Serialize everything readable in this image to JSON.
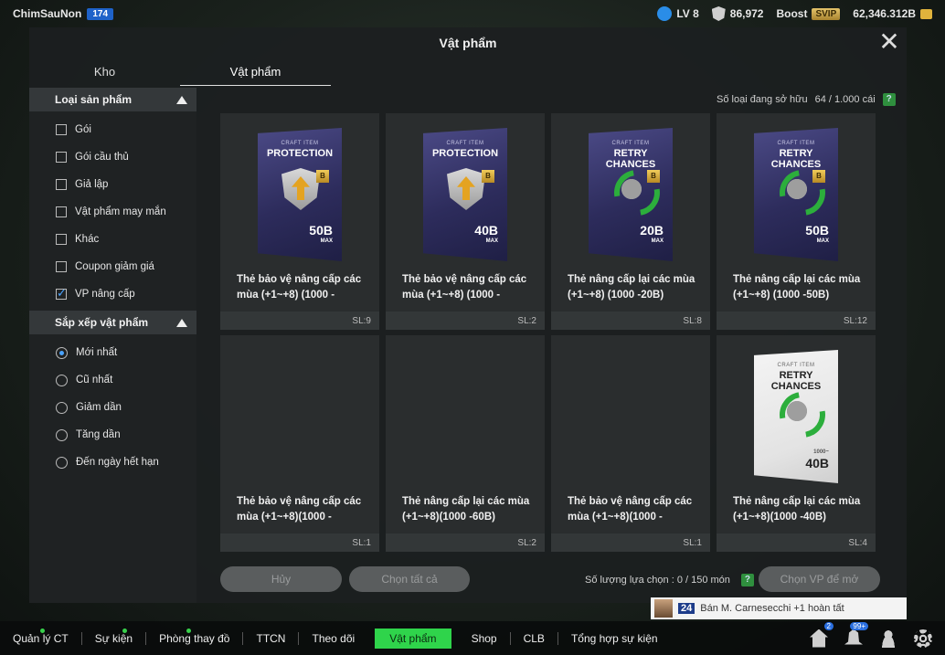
{
  "top": {
    "username": "ChimSauNon",
    "user_level": "174",
    "lv": "LV 8",
    "currency": "86,972",
    "boost_label": "Boost",
    "svip": "SVIP",
    "bp": "62,346.312B"
  },
  "modal": {
    "title": "Vật phẩm",
    "tabs": [
      "Kho",
      "Vật phẩm"
    ],
    "owned_label": "Số loại đang sở hữu",
    "owned_value": "64 / 1.000 cái"
  },
  "sidebar": {
    "product_type_title": "Loại sản phẩm",
    "product_types": [
      {
        "label": "Gói",
        "checked": false
      },
      {
        "label": "Gói cầu thủ",
        "checked": false
      },
      {
        "label": "Giả lập",
        "checked": false
      },
      {
        "label": "Vật phẩm may mắn",
        "checked": false
      },
      {
        "label": "Khác",
        "checked": false
      },
      {
        "label": "Coupon giảm giá",
        "checked": false
      },
      {
        "label": "VP nâng cấp",
        "checked": true
      }
    ],
    "sort_title": "Sắp xếp vật phẩm",
    "sort_options": [
      {
        "label": "Mới nhất",
        "checked": true
      },
      {
        "label": "Cũ nhất",
        "checked": false
      },
      {
        "label": "Giảm dần",
        "checked": false
      },
      {
        "label": "Tăng dần",
        "checked": false
      },
      {
        "label": "Đến ngày hết hạn",
        "checked": false
      }
    ]
  },
  "items": [
    {
      "name": "Thẻ bảo vệ nâng cấp các mùa (+1~+8) (1000 -",
      "qty": "SL:9",
      "card": {
        "kind": "protection",
        "top": "CRAFT ITEM",
        "title": "PROTECTION",
        "value": "50",
        "unit": "B",
        "sub": "MAX",
        "badge": "B"
      }
    },
    {
      "name": "Thẻ bảo vệ nâng cấp các mùa (+1~+8) (1000 -",
      "qty": "SL:2",
      "card": {
        "kind": "protection",
        "top": "CRAFT ITEM",
        "title": "PROTECTION",
        "value": "40",
        "unit": "B",
        "sub": "MAX",
        "badge": "B"
      }
    },
    {
      "name": "Thẻ nâng cấp lại các mùa (+1~+8) (1000 -20B)",
      "qty": "SL:8",
      "card": {
        "kind": "retry",
        "top": "CRAFT ITEM",
        "title": "RETRY CHANCES",
        "value": "20",
        "unit": "B",
        "sub": "MAX",
        "badge": "B"
      }
    },
    {
      "name": "Thẻ nâng cấp lại các mùa (+1~+8) (1000 -50B)",
      "qty": "SL:12",
      "card": {
        "kind": "retry",
        "top": "CRAFT ITEM",
        "title": "RETRY CHANCES",
        "value": "50",
        "unit": "B",
        "sub": "MAX",
        "badge": "B"
      }
    },
    {
      "name": "Thẻ bảo vệ nâng cấp các mùa (+1~+8)(1000 -",
      "qty": "SL:1",
      "card": null
    },
    {
      "name": "Thẻ nâng cấp lại các mùa (+1~+8)(1000 -60B)",
      "qty": "SL:2",
      "card": null
    },
    {
      "name": "Thẻ bảo vệ nâng cấp các mùa (+1~+8)(1000 -",
      "qty": "SL:1",
      "card": null
    },
    {
      "name": "Thẻ nâng cấp lại các mùa (+1~+8)(1000 -40B)",
      "qty": "SL:4",
      "card": {
        "kind": "retry-white",
        "top": "CRAFT ITEM",
        "title": "RETRY CHANCES",
        "value": "40B",
        "unit": "",
        "sub": "1000~",
        "badge": ""
      }
    }
  ],
  "actions": {
    "cancel": "Hủy",
    "select_all": "Chọn tất cả",
    "selected_count_label": "Số lượng lựa chọn : 0 / 150 món",
    "open_selected": "Chọn VP để mở"
  },
  "notification": {
    "rank": "24",
    "text": "Bán M. Carnesecchi +1 hoàn tất"
  },
  "bottom_nav": [
    {
      "label": "Quản lý CT",
      "dot": true,
      "active": false
    },
    {
      "label": "Sự kiện",
      "dot": true,
      "active": false
    },
    {
      "label": "Phòng thay đồ",
      "dot": true,
      "active": false
    },
    {
      "label": "TTCN",
      "dot": false,
      "active": false
    },
    {
      "label": "Theo dõi",
      "dot": false,
      "active": false
    },
    {
      "label": "Vật phẩm",
      "dot": false,
      "active": true
    },
    {
      "label": "Shop",
      "dot": false,
      "active": false
    },
    {
      "label": "CLB",
      "dot": false,
      "active": false
    },
    {
      "label": "Tổng hợp sự kiện",
      "dot": false,
      "active": false
    }
  ],
  "nav_badges": {
    "home": "2",
    "bell": "99+"
  },
  "colors": {
    "accent_green": "#2fd44b",
    "check_blue": "#4aa3ff",
    "lv_badge_blue": "#1e62c9"
  }
}
